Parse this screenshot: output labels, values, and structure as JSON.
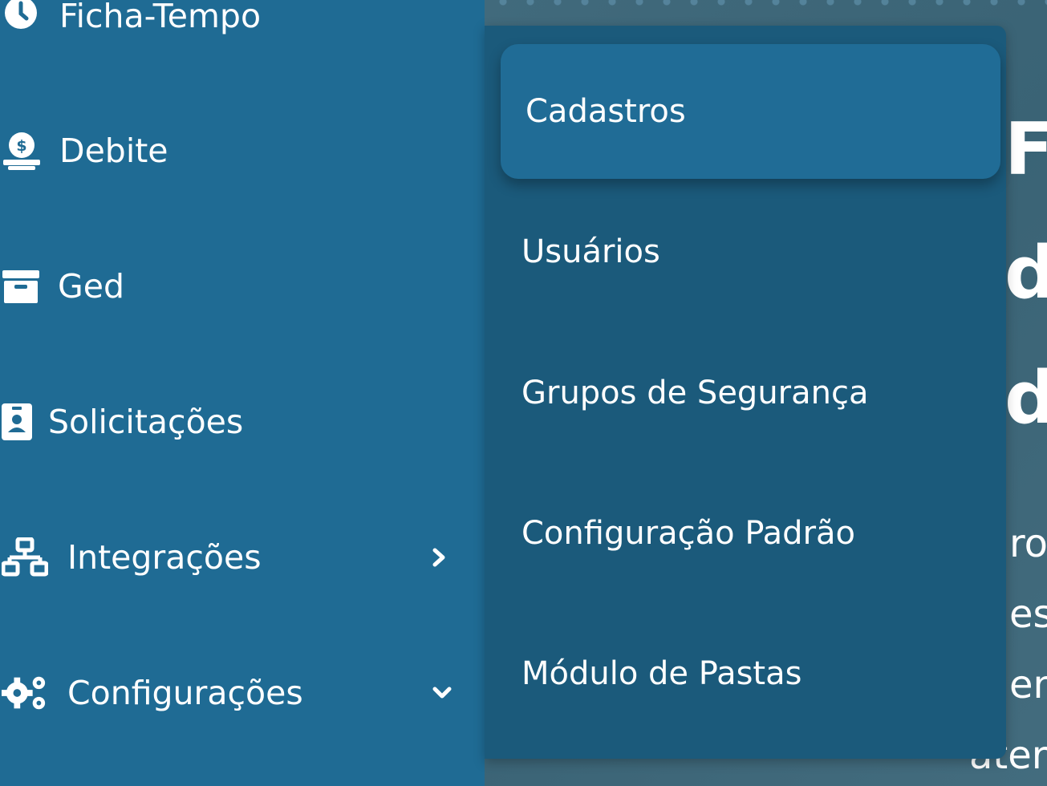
{
  "sidebar": {
    "items": [
      {
        "label": "Ficha-Tempo",
        "icon": "clock-icon"
      },
      {
        "label": "Debite",
        "icon": "money-hand-icon"
      },
      {
        "label": "Ged",
        "icon": "archive-icon"
      },
      {
        "label": "Solicitações",
        "icon": "id-badge-icon"
      },
      {
        "label": "Integrações",
        "icon": "network-icon",
        "chevron": "chevron-right-icon"
      },
      {
        "label": "Configurações",
        "icon": "cogs-icon",
        "chevron": "chevron-down-icon"
      }
    ]
  },
  "submenu": {
    "items": [
      {
        "label": "Cadastros",
        "active": true
      },
      {
        "label": "Usuários"
      },
      {
        "label": "Grupos de Segurança"
      },
      {
        "label": "Configuração Padrão"
      },
      {
        "label": "Módulo de Pastas"
      }
    ]
  },
  "background": {
    "heading_lines": [
      "Fi",
      "d",
      "d"
    ],
    "text_lines": [
      "ro",
      "es",
      "en",
      "ater"
    ]
  },
  "colors": {
    "sidebar": "#1f6b94",
    "submenu": "#1b5a7b",
    "active_item": "#206c96",
    "text": "#ffffff"
  }
}
